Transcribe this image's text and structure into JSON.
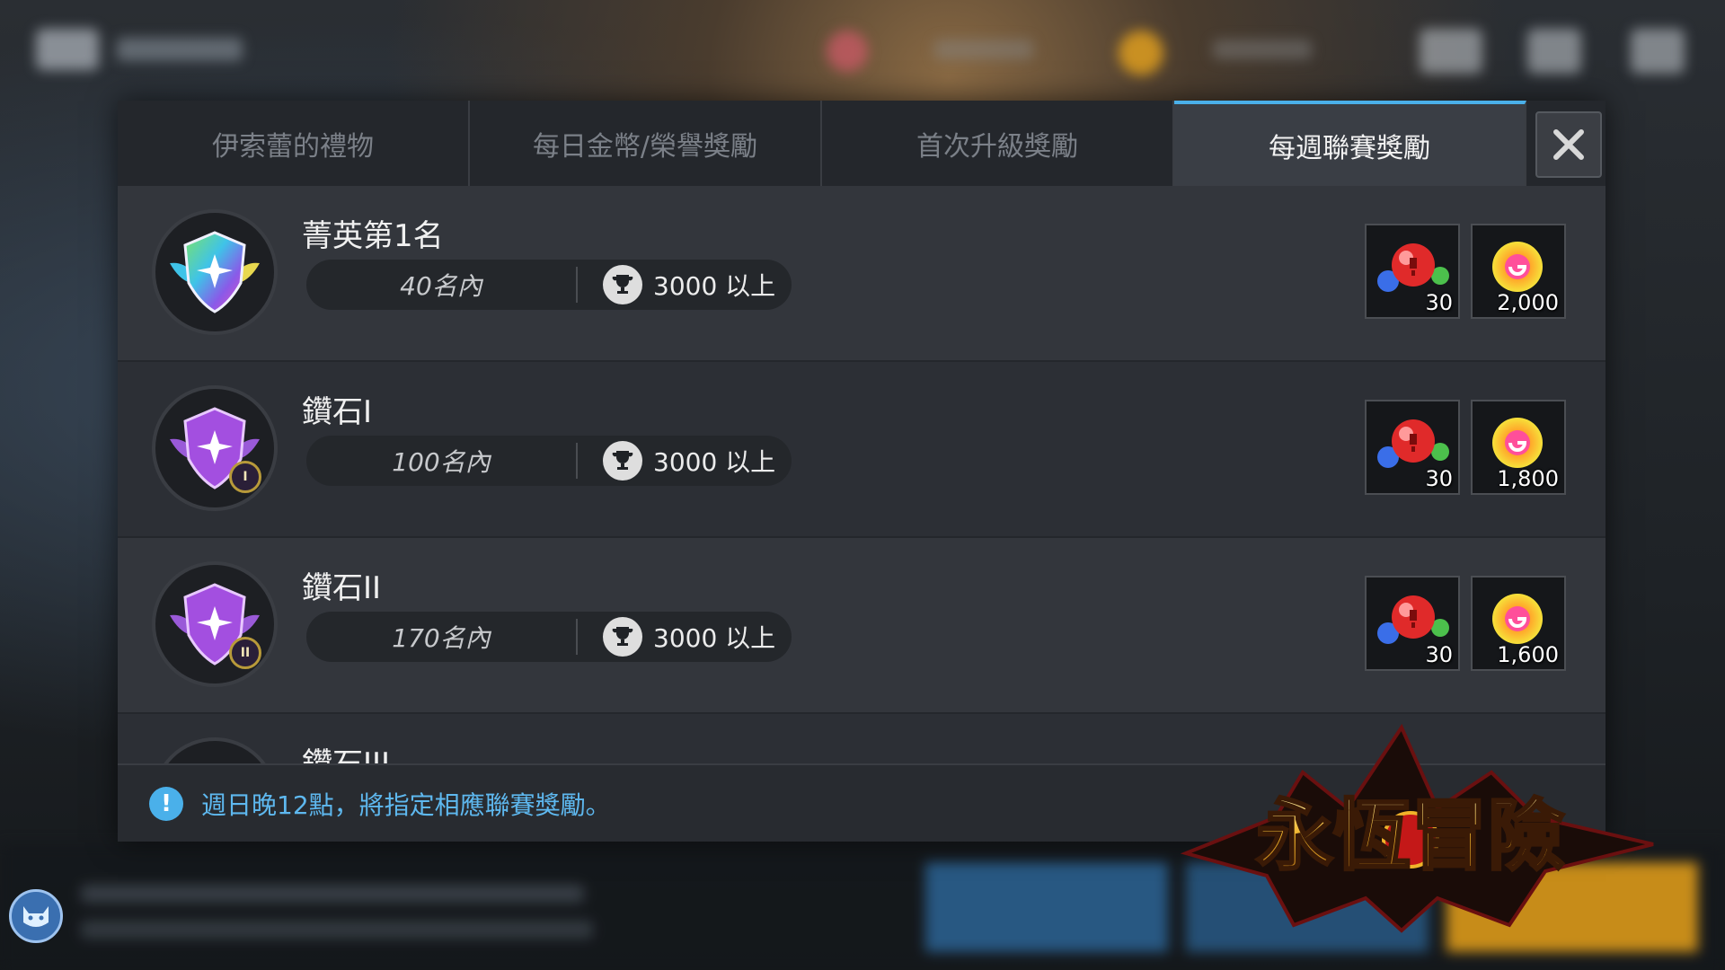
{
  "tabs": [
    {
      "label": "伊索蕾的禮物",
      "active": false
    },
    {
      "label": "每日金幣/榮譽獎勵",
      "active": false
    },
    {
      "label": "首次升級獎勵",
      "active": false
    },
    {
      "label": "每週聯賽獎勵",
      "active": true
    }
  ],
  "tiers": [
    {
      "name": "菁英第1名",
      "rank": "40名內",
      "trophy": "3000 以上",
      "badge": "rainbow",
      "tier_mark": "",
      "rewards": [
        {
          "icon": "red-gem-bundle-icon",
          "amount": "30"
        },
        {
          "icon": "rainbow-orb-icon",
          "amount": "2,000"
        }
      ]
    },
    {
      "name": "鑽石I",
      "rank": "100名內",
      "trophy": "3000 以上",
      "badge": "purple",
      "tier_mark": "I",
      "rewards": [
        {
          "icon": "red-gem-bundle-icon",
          "amount": "30"
        },
        {
          "icon": "rainbow-orb-icon",
          "amount": "1,800"
        }
      ]
    },
    {
      "name": "鑽石II",
      "rank": "170名內",
      "trophy": "3000 以上",
      "badge": "purple",
      "tier_mark": "II",
      "rewards": [
        {
          "icon": "red-gem-bundle-icon",
          "amount": "30"
        },
        {
          "icon": "rainbow-orb-icon",
          "amount": "1,600"
        }
      ]
    },
    {
      "name": "鑽石III",
      "rank": "",
      "trophy": "",
      "badge": "purple",
      "tier_mark": "",
      "rewards": []
    }
  ],
  "footer": {
    "notice": "週日晚12點，將指定相應聯賽獎勵。"
  },
  "logo": {
    "text": "永恆冒險"
  },
  "colors": {
    "accent": "#4ab0ea",
    "panel": "#2c2f35",
    "gold": "#e7a21a"
  }
}
